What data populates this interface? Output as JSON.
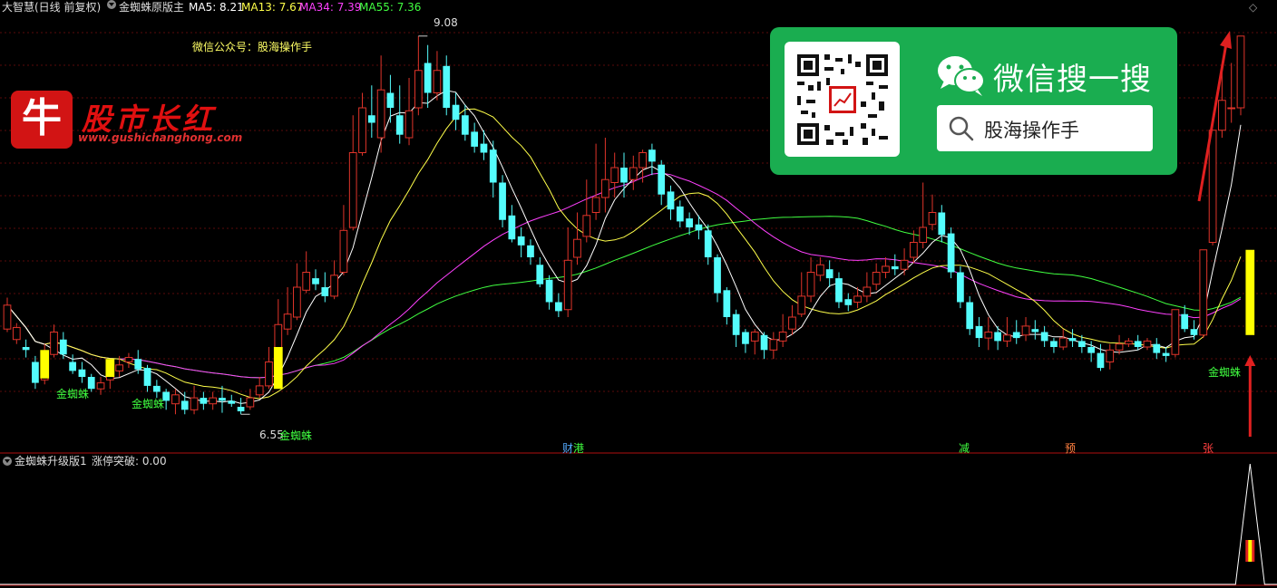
{
  "main_header": {
    "title": "大智慧(日线 前复权)",
    "indicator": "金蜘蛛原版主",
    "ma5": "MA5: 8.21",
    "ma13": "MA13: 7.67",
    "ma34": "MA34: 7.39",
    "ma55": "MA55: 7.36",
    "corner_icon": "diamond-icon"
  },
  "colors": {
    "up": "#e0342a",
    "down": "#54fcfc",
    "ma5": "#ffffff",
    "ma13": "#ffff4a",
    "ma34": "#ff40ff",
    "ma55": "#40ff40",
    "signal_bar": "#ffff00",
    "wechat_green": "#1aad50",
    "divider": "#b01010"
  },
  "annotations": {
    "wechat_note": "微信公众号：股海操作手",
    "high_price": "9.08",
    "low_price": "6.55",
    "golden_spider": "金蜘蛛",
    "event_caijing": "财",
    "event_gang": "港",
    "event_jian": "减",
    "event_yu": "预",
    "event_zhang": "张"
  },
  "logo": {
    "bull_char": "牛",
    "brand": "股市长红",
    "url": "www.gushichanghong.com"
  },
  "wechat_ad": {
    "title": "微信搜一搜",
    "search_text": "股海操作手",
    "icons": [
      "qr-code-icon",
      "wechat-icon",
      "search-icon"
    ]
  },
  "sub_header": {
    "indicator": "金蜘蛛升级版1",
    "value_label": "涨停突破: 0.00"
  },
  "chart_data": {
    "type": "candlestick",
    "price_range": [
      6.4,
      9.2
    ],
    "candles": [
      [
        7.12,
        7.28,
        7.1,
        7.33
      ],
      [
        7.05,
        7.13,
        7.02,
        7.16
      ],
      [
        7.0,
        6.98,
        6.93,
        7.05
      ],
      [
        6.9,
        6.76,
        6.72,
        6.94
      ],
      [
        6.78,
        6.94,
        6.75,
        7.02
      ],
      [
        6.95,
        7.1,
        6.93,
        7.15
      ],
      [
        7.05,
        6.95,
        6.92,
        7.1
      ],
      [
        6.9,
        6.84,
        6.82,
        6.95
      ],
      [
        6.85,
        6.8,
        6.76,
        6.9
      ],
      [
        6.8,
        6.72,
        6.7,
        6.82
      ],
      [
        6.72,
        6.76,
        6.68,
        6.8
      ],
      [
        6.78,
        6.82,
        6.72,
        6.86
      ],
      [
        6.84,
        6.88,
        6.8,
        6.94
      ],
      [
        6.9,
        6.93,
        6.86,
        6.96
      ],
      [
        6.92,
        6.85,
        6.82,
        6.98
      ],
      [
        6.86,
        6.74,
        6.7,
        6.88
      ],
      [
        6.74,
        6.7,
        6.66,
        6.78
      ],
      [
        6.7,
        6.64,
        6.58,
        6.72
      ],
      [
        6.62,
        6.68,
        6.55,
        6.72
      ],
      [
        6.64,
        6.58,
        6.55,
        6.7
      ],
      [
        6.58,
        6.66,
        6.55,
        6.74
      ],
      [
        6.66,
        6.62,
        6.58,
        6.7
      ],
      [
        6.62,
        6.66,
        6.58,
        6.7
      ],
      [
        6.66,
        6.64,
        6.56,
        6.74
      ],
      [
        6.64,
        6.62,
        6.6,
        6.68
      ],
      [
        6.6,
        6.57,
        6.55,
        6.66
      ],
      [
        6.6,
        6.66,
        6.58,
        6.72
      ],
      [
        6.68,
        6.74,
        6.66,
        6.8
      ],
      [
        6.74,
        6.9,
        6.72,
        7.0
      ],
      [
        6.92,
        7.15,
        6.9,
        7.32
      ],
      [
        7.12,
        7.22,
        7.08,
        7.4
      ],
      [
        7.2,
        7.4,
        7.18,
        7.56
      ],
      [
        7.38,
        7.5,
        7.36,
        7.64
      ],
      [
        7.46,
        7.42,
        7.38,
        7.52
      ],
      [
        7.4,
        7.34,
        7.3,
        7.5
      ],
      [
        7.34,
        7.48,
        7.32,
        7.58
      ],
      [
        7.5,
        7.78,
        7.48,
        7.95
      ],
      [
        7.8,
        8.3,
        7.78,
        8.55
      ],
      [
        8.3,
        8.6,
        8.28,
        8.7
      ],
      [
        8.55,
        8.5,
        8.4,
        8.75
      ],
      [
        8.4,
        8.72,
        8.3,
        8.95
      ],
      [
        8.7,
        8.6,
        8.5,
        8.82
      ],
      [
        8.55,
        8.42,
        8.36,
        8.75
      ],
      [
        8.4,
        8.58,
        8.35,
        8.8
      ],
      [
        8.6,
        8.85,
        8.55,
        9.08
      ],
      [
        8.9,
        8.7,
        8.6,
        9.02
      ],
      [
        8.7,
        8.85,
        8.65,
        8.98
      ],
      [
        8.88,
        8.6,
        8.55,
        8.95
      ],
      [
        8.62,
        8.52,
        8.45,
        8.7
      ],
      [
        8.55,
        8.42,
        8.38,
        8.62
      ],
      [
        8.44,
        8.34,
        8.3,
        8.5
      ],
      [
        8.36,
        8.3,
        8.25,
        8.45
      ],
      [
        8.32,
        8.1,
        8.0,
        8.38
      ],
      [
        8.1,
        7.85,
        7.8,
        8.15
      ],
      [
        7.88,
        7.72,
        7.7,
        7.95
      ],
      [
        7.74,
        7.68,
        7.6,
        7.8
      ],
      [
        7.68,
        7.6,
        7.55,
        7.72
      ],
      [
        7.55,
        7.42,
        7.4,
        7.6
      ],
      [
        7.45,
        7.3,
        7.25,
        7.48
      ],
      [
        7.3,
        7.24,
        7.2,
        7.36
      ],
      [
        7.25,
        7.58,
        7.2,
        7.8
      ],
      [
        7.6,
        7.72,
        7.55,
        7.9
      ],
      [
        7.74,
        7.88,
        7.7,
        8.12
      ],
      [
        7.9,
        8.0,
        7.85,
        8.36
      ],
      [
        8.0,
        8.12,
        7.9,
        8.4
      ],
      [
        8.1,
        8.2,
        8.0,
        8.3
      ],
      [
        8.2,
        8.1,
        8.0,
        8.3
      ],
      [
        8.12,
        8.2,
        8.05,
        8.28
      ],
      [
        8.2,
        8.3,
        8.1,
        8.32
      ],
      [
        8.32,
        8.24,
        8.15,
        8.36
      ],
      [
        8.22,
        8.02,
        7.95,
        8.25
      ],
      [
        8.04,
        7.92,
        7.85,
        8.08
      ],
      [
        7.94,
        7.84,
        7.8,
        7.98
      ],
      [
        7.86,
        7.8,
        7.75,
        7.9
      ],
      [
        7.82,
        7.78,
        7.72,
        7.88
      ],
      [
        7.78,
        7.6,
        7.55,
        7.82
      ],
      [
        7.6,
        7.36,
        7.3,
        7.62
      ],
      [
        7.38,
        7.2,
        7.15,
        7.4
      ],
      [
        7.22,
        7.08,
        7.0,
        7.25
      ],
      [
        7.1,
        7.02,
        6.96,
        7.12
      ],
      [
        7.04,
        7.1,
        6.95,
        7.12
      ],
      [
        7.08,
        6.98,
        6.92,
        7.1
      ],
      [
        6.98,
        7.05,
        6.92,
        7.1
      ],
      [
        7.04,
        7.1,
        7.0,
        7.22
      ],
      [
        7.12,
        7.2,
        7.08,
        7.28
      ],
      [
        7.22,
        7.34,
        7.2,
        7.5
      ],
      [
        7.34,
        7.5,
        7.3,
        7.6
      ],
      [
        7.48,
        7.55,
        7.44,
        7.6
      ],
      [
        7.52,
        7.46,
        7.4,
        7.58
      ],
      [
        7.46,
        7.3,
        7.26,
        7.5
      ],
      [
        7.32,
        7.28,
        7.24,
        7.36
      ],
      [
        7.3,
        7.34,
        7.26,
        7.4
      ],
      [
        7.34,
        7.4,
        7.3,
        7.5
      ],
      [
        7.42,
        7.5,
        7.38,
        7.56
      ],
      [
        7.5,
        7.54,
        7.46,
        7.6
      ],
      [
        7.54,
        7.52,
        7.48,
        7.62
      ],
      [
        7.52,
        7.58,
        7.48,
        7.66
      ],
      [
        7.6,
        7.7,
        7.56,
        7.78
      ],
      [
        7.7,
        7.8,
        7.66,
        8.1
      ],
      [
        7.82,
        7.9,
        7.78,
        8.02
      ],
      [
        7.9,
        7.75,
        7.7,
        7.95
      ],
      [
        7.76,
        7.5,
        7.46,
        7.8
      ],
      [
        7.5,
        7.3,
        7.26,
        7.54
      ],
      [
        7.3,
        7.12,
        7.08,
        7.34
      ],
      [
        7.14,
        7.06,
        7.0,
        7.2
      ],
      [
        7.06,
        7.1,
        6.98,
        7.2
      ],
      [
        7.1,
        7.04,
        6.98,
        7.14
      ],
      [
        7.04,
        7.08,
        7.0,
        7.2
      ],
      [
        7.1,
        7.06,
        7.02,
        7.18
      ],
      [
        7.08,
        7.14,
        7.04,
        7.2
      ],
      [
        7.12,
        7.1,
        7.05,
        7.18
      ],
      [
        7.1,
        7.04,
        7.0,
        7.14
      ],
      [
        7.04,
        7.0,
        6.96,
        7.06
      ],
      [
        7.0,
        7.06,
        6.98,
        7.12
      ],
      [
        7.06,
        7.04,
        7.0,
        7.12
      ],
      [
        7.04,
        7.0,
        6.96,
        7.08
      ],
      [
        7.0,
        6.96,
        6.9,
        7.04
      ],
      [
        6.96,
        6.86,
        6.84,
        7.02
      ],
      [
        6.9,
        6.98,
        6.85,
        7.02
      ],
      [
        6.98,
        7.02,
        6.95,
        7.08
      ],
      [
        7.02,
        7.04,
        7.0,
        7.06
      ],
      [
        7.04,
        7.0,
        6.98,
        7.08
      ],
      [
        7.0,
        7.04,
        6.98,
        7.06
      ],
      [
        7.02,
        6.96,
        6.92,
        7.06
      ],
      [
        6.96,
        6.94,
        6.9,
        7.0
      ],
      [
        6.95,
        7.25,
        6.93,
        7.25
      ],
      [
        7.22,
        7.12,
        7.1,
        7.28
      ],
      [
        7.12,
        7.08,
        7.05,
        7.18
      ],
      [
        7.08,
        7.65,
        7.06,
        7.65
      ],
      [
        7.7,
        8.45,
        7.68,
        8.45
      ],
      [
        8.45,
        8.65,
        8.4,
        8.85
      ],
      [
        8.6,
        8.6,
        8.5,
        8.9
      ],
      [
        8.6,
        9.08,
        8.55,
        9.08
      ]
    ],
    "signal_bars": [
      {
        "index": 4,
        "low": 6.79,
        "high": 6.98
      },
      {
        "index": 11,
        "low": 6.8,
        "high": 6.92
      },
      {
        "index": 29,
        "low": 6.72,
        "high": 7.0
      },
      {
        "index": 133,
        "low": 7.08,
        "high": 7.65
      }
    ],
    "sub_indicator": {
      "label": "涨停突破",
      "value": 0.0,
      "peak_index": 133
    }
  }
}
